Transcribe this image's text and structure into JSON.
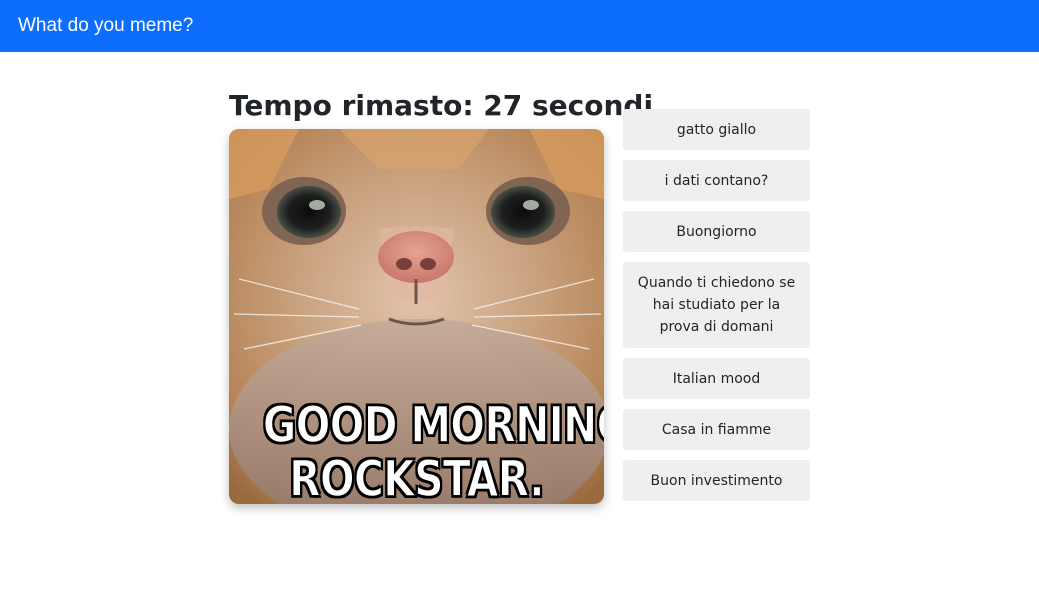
{
  "navbar": {
    "brand": "What do you meme?",
    "color": "#0d6efd"
  },
  "game": {
    "timer_text": "Tempo rimasto: 27 secondi",
    "meme": {
      "image": "orange-cat-closeup",
      "caption_line1": "GOOD MORNING,",
      "caption_line2": "ROCKSTAR."
    },
    "options": [
      "gatto giallo",
      "i dati contano?",
      "Buongiorno",
      "Quando ti chiedono se hai studiato per la prova di domani",
      "Italian mood",
      "Casa in fiamme",
      "Buon investimento"
    ]
  }
}
